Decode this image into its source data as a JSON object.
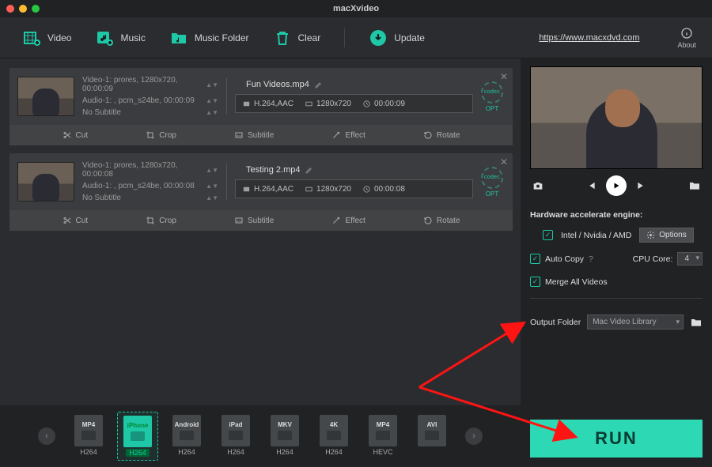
{
  "app": {
    "title": "macXvideo"
  },
  "toolbar": {
    "video": "Video",
    "music": "Music",
    "music_folder": "Music Folder",
    "clear": "Clear",
    "update": "Update",
    "url": "https://www.macxdvd.com",
    "about": "About"
  },
  "items": [
    {
      "video_track": "Video-1: prores, 1280x720, 00:00:09",
      "audio_track": "Audio-1: , pcm_s24be, 00:00:09",
      "subtitle": "No Subtitle",
      "filename": "Fun Videos.mp4",
      "codec": "H.264,AAC",
      "resolution": "1280x720",
      "duration": "00:00:09",
      "opt": "OPT"
    },
    {
      "video_track": "Video-1: prores, 1280x720, 00:00:08",
      "audio_track": "Audio-1: , pcm_s24be, 00:00:08",
      "subtitle": "No Subtitle",
      "filename": "Testing 2.mp4",
      "codec": "H.264,AAC",
      "resolution": "1280x720",
      "duration": "00:00:08",
      "opt": "OPT"
    }
  ],
  "tools": {
    "cut": "Cut",
    "crop": "Crop",
    "subtitle": "Subtitle",
    "effect": "Effect",
    "rotate": "Rotate"
  },
  "formats": [
    {
      "top": "MP4",
      "bot": "H264"
    },
    {
      "top": "iPhone",
      "bot": "H264"
    },
    {
      "top": "Android",
      "bot": "H264"
    },
    {
      "top": "iPad",
      "bot": "H264"
    },
    {
      "top": "MKV",
      "bot": "H264"
    },
    {
      "top": "4K",
      "bot": "H264"
    },
    {
      "top": "MP4",
      "bot": "HEVC"
    },
    {
      "top": "AVI",
      "bot": ""
    }
  ],
  "right": {
    "hw_label": "Hardware accelerate engine:",
    "hw_vendor": "Intel / Nvidia / AMD",
    "options": "Options",
    "auto_copy": "Auto Copy",
    "cpu_core_label": "CPU Core:",
    "cpu_core": "4",
    "merge": "Merge All Videos",
    "output_folder_label": "Output Folder",
    "output_folder": "Mac Video Library",
    "run": "RUN"
  }
}
